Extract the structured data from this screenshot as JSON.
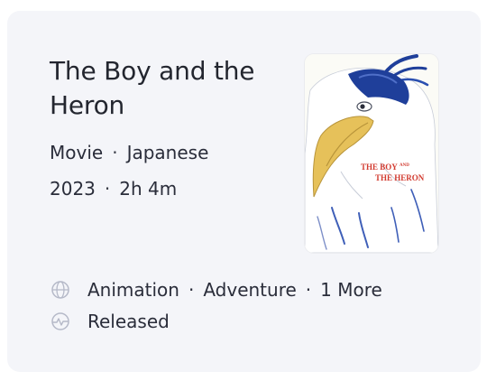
{
  "card": {
    "title": "The Boy and the Heron",
    "type": "Movie",
    "language": "Japanese",
    "year": "2023",
    "runtime": "2h 4m",
    "poster": {
      "title_line1": "THE BOY",
      "title_and": "AND",
      "title_line2": "THE HERON"
    },
    "genres": [
      "Animation",
      "Adventure",
      "1 More"
    ],
    "status": "Released",
    "icons": {
      "genre": "globe-icon",
      "status": "activity-icon"
    },
    "separator": "·",
    "colors": {
      "background": "#f4f5f9",
      "text": "#2a2d3a",
      "icon": "#b5b9c8",
      "heron_blue": "#1f3f9a",
      "heron_beak": "#e6c15a",
      "poster_title": "#d23a2f"
    }
  }
}
